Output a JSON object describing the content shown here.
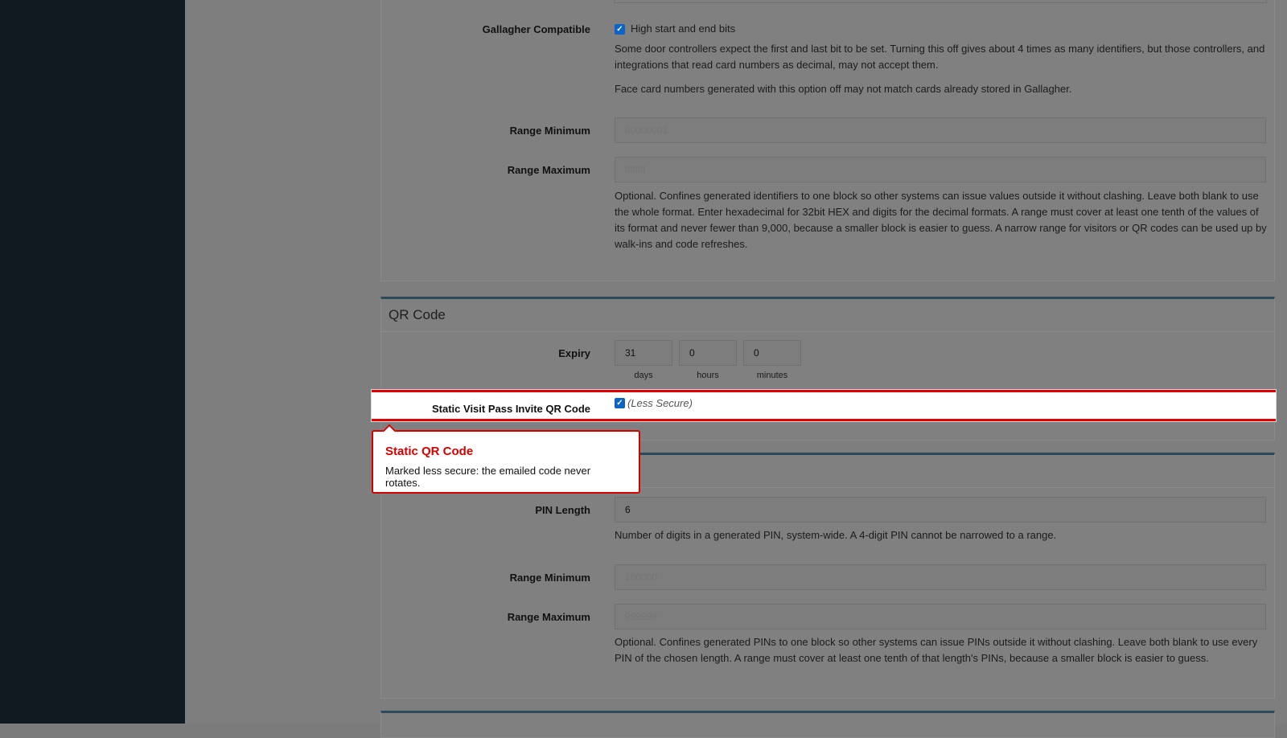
{
  "gallagher": {
    "label": "Gallagher Compatible",
    "checkbox_label": "High start and end bits",
    "checked": true,
    "help1": "Some door controllers expect the first and last bit to be set. Turning this off gives about 4 times as many identifiers, but those controllers, and integrations that read card numbers as decimal, may not accept them.",
    "help2": "Face card numbers generated with this option off may not match cards already stored in Gallagher."
  },
  "card_range": {
    "min_label": "Range Minimum",
    "min_placeholder": "80000001",
    "max_label": "Range Maximum",
    "max_placeholder": "ffffffff",
    "help": "Optional. Confines generated identifiers to one block so other systems can issue values outside it without clashing. Leave both blank to use the whole format. Enter hexadecimal for 32bit HEX and digits for the decimal formats. A range must cover at least one tenth of the values of its format and never fewer than 9,000, because a smaller block is easier to guess. A narrow range for visitors or QR codes can be used up by walk-ins and code refreshes."
  },
  "qr": {
    "title": "QR Code",
    "expiry_label": "Expiry",
    "days": "31",
    "hours": "0",
    "minutes": "0",
    "days_unit": "days",
    "hours_unit": "hours",
    "minutes_unit": "minutes",
    "static_label": "Static Visit Pass Invite QR Code",
    "static_checked": true,
    "static_note": "(Less Secure)"
  },
  "tooltip": {
    "title": "Static QR Code",
    "body": "Marked less secure: the emailed code never rotates."
  },
  "pin": {
    "length_label": "PIN Length",
    "length_value": "6",
    "length_help": "Number of digits in a generated PIN, system-wide. A 4-digit PIN cannot be narrowed to a range.",
    "min_label": "Range Minimum",
    "min_placeholder": "100000",
    "max_label": "Range Maximum",
    "max_placeholder": "999999",
    "help": "Optional. Confines generated PINs to one block so other systems can issue PINs outside it without clashing. Leave both blank to use every PIN of the chosen length. A range must cover at least one tenth of that length's PINs, because a smaller block is easier to guess."
  },
  "colors": {
    "accent": "#d40000",
    "checkbox": "#0b63c8",
    "sidebar": "#111a20"
  }
}
